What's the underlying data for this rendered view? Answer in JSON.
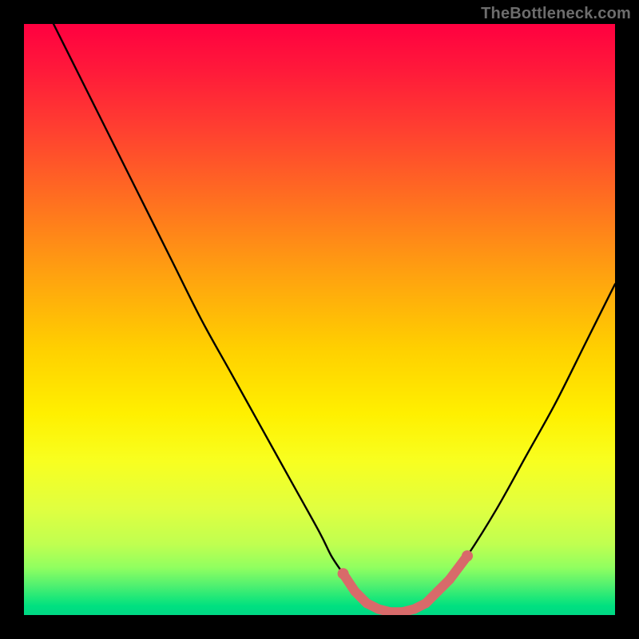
{
  "watermark": "TheBottleneck.com",
  "colors": {
    "background": "#000000",
    "curve_stroke": "#000000",
    "marker_fill": "#d86a6a",
    "marker_stroke": "#c24f4f"
  },
  "chart_data": {
    "type": "line",
    "title": "",
    "xlabel": "",
    "ylabel": "",
    "xlim": [
      0,
      100
    ],
    "ylim": [
      0,
      100
    ],
    "grid": false,
    "legend": false,
    "series": [
      {
        "name": "bottleneck-curve",
        "x": [
          5,
          10,
          15,
          20,
          25,
          30,
          35,
          40,
          45,
          50,
          52,
          54,
          56,
          58,
          60,
          62,
          64,
          66,
          68,
          70,
          72,
          75,
          80,
          85,
          90,
          95,
          100
        ],
        "y": [
          100,
          90,
          80,
          70,
          60,
          50,
          41,
          32,
          23,
          14,
          10,
          7,
          4,
          2,
          1,
          0.5,
          0.5,
          1,
          2,
          4,
          6,
          10,
          18,
          27,
          36,
          46,
          56
        ]
      }
    ],
    "markers": {
      "name": "valley-highlight",
      "x": [
        54,
        56,
        58,
        60,
        62,
        64,
        66,
        68,
        70,
        72,
        75
      ],
      "y": [
        7,
        4,
        2,
        1,
        0.5,
        0.5,
        1,
        2,
        4,
        6,
        10
      ]
    }
  }
}
